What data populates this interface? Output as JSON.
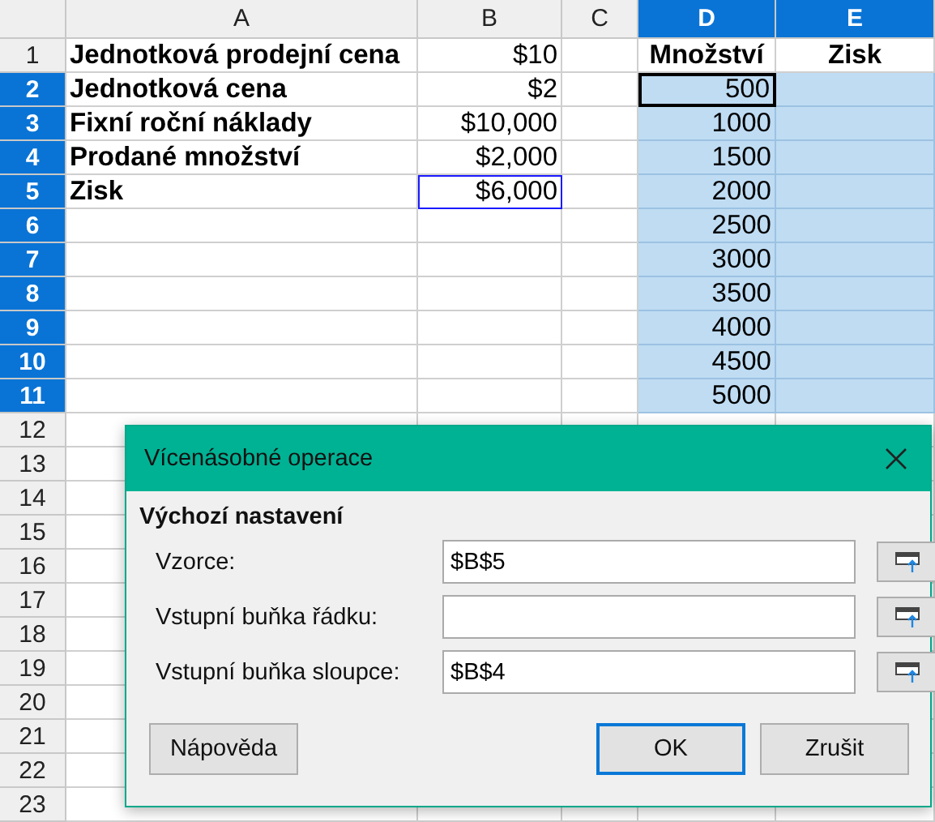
{
  "sheet": {
    "columns": [
      {
        "label": "A",
        "selected": false
      },
      {
        "label": "B",
        "selected": false
      },
      {
        "label": "C",
        "selected": false
      },
      {
        "label": "D",
        "selected": true
      },
      {
        "label": "E",
        "selected": true
      }
    ],
    "rows": [
      {
        "header": "1",
        "selected": false,
        "cells": [
          {
            "text": "Jednotková prodejní cena",
            "kind": "label",
            "selected": false
          },
          {
            "text": "$10",
            "kind": "number",
            "selected": false
          },
          {
            "selected": false
          },
          {
            "text": "Množství",
            "kind": "heading",
            "selected": false
          },
          {
            "text": "Zisk",
            "kind": "heading",
            "selected": false
          }
        ]
      },
      {
        "header": "2",
        "selected": true,
        "cells": [
          {
            "text": "Jednotková cena",
            "kind": "label",
            "selected": false
          },
          {
            "text": "$2",
            "kind": "number",
            "selected": false
          },
          {
            "selected": false
          },
          {
            "text": "500",
            "kind": "number",
            "selected": true,
            "active": true
          },
          {
            "selected": true
          }
        ]
      },
      {
        "header": "3",
        "selected": true,
        "cells": [
          {
            "text": "Fixní roční náklady",
            "kind": "label",
            "selected": false
          },
          {
            "text": "$10,000",
            "kind": "number",
            "selected": false
          },
          {
            "selected": false
          },
          {
            "text": "1000",
            "kind": "number",
            "selected": true
          },
          {
            "selected": true
          }
        ]
      },
      {
        "header": "4",
        "selected": true,
        "cells": [
          {
            "text": "Prodané množství",
            "kind": "label",
            "selected": false
          },
          {
            "text": "$2,000",
            "kind": "number",
            "selected": false
          },
          {
            "selected": false
          },
          {
            "text": "1500",
            "kind": "number",
            "selected": true
          },
          {
            "selected": true
          }
        ]
      },
      {
        "header": "5",
        "selected": true,
        "cells": [
          {
            "text": "Zisk",
            "kind": "label",
            "selected": false
          },
          {
            "text": "$6,000",
            "kind": "number",
            "selected": false,
            "referenced": true
          },
          {
            "selected": false
          },
          {
            "text": "2000",
            "kind": "number",
            "selected": true
          },
          {
            "selected": true
          }
        ]
      },
      {
        "header": "6",
        "selected": true,
        "cells": [
          {
            "selected": false
          },
          {
            "selected": false
          },
          {
            "selected": false
          },
          {
            "text": "2500",
            "kind": "number",
            "selected": true
          },
          {
            "selected": true
          }
        ]
      },
      {
        "header": "7",
        "selected": true,
        "cells": [
          {
            "selected": false
          },
          {
            "selected": false
          },
          {
            "selected": false
          },
          {
            "text": "3000",
            "kind": "number",
            "selected": true
          },
          {
            "selected": true
          }
        ]
      },
      {
        "header": "8",
        "selected": true,
        "cells": [
          {
            "selected": false
          },
          {
            "selected": false
          },
          {
            "selected": false
          },
          {
            "text": "3500",
            "kind": "number",
            "selected": true
          },
          {
            "selected": true
          }
        ]
      },
      {
        "header": "9",
        "selected": true,
        "cells": [
          {
            "selected": false
          },
          {
            "selected": false
          },
          {
            "selected": false
          },
          {
            "text": "4000",
            "kind": "number",
            "selected": true
          },
          {
            "selected": true
          }
        ]
      },
      {
        "header": "10",
        "selected": true,
        "cells": [
          {
            "selected": false
          },
          {
            "selected": false
          },
          {
            "selected": false
          },
          {
            "text": "4500",
            "kind": "number",
            "selected": true
          },
          {
            "selected": true
          }
        ]
      },
      {
        "header": "11",
        "selected": true,
        "cells": [
          {
            "selected": false
          },
          {
            "selected": false
          },
          {
            "selected": false
          },
          {
            "text": "5000",
            "kind": "number",
            "selected": true
          },
          {
            "selected": true
          }
        ]
      },
      {
        "header": "12",
        "selected": false
      },
      {
        "header": "13",
        "selected": false
      },
      {
        "header": "14",
        "selected": false
      },
      {
        "header": "15",
        "selected": false
      },
      {
        "header": "16",
        "selected": false
      },
      {
        "header": "17",
        "selected": false
      },
      {
        "header": "18",
        "selected": false
      },
      {
        "header": "19",
        "selected": false
      },
      {
        "header": "20",
        "selected": false
      },
      {
        "header": "21",
        "selected": false
      },
      {
        "header": "22",
        "selected": false
      },
      {
        "header": "23",
        "selected": false
      }
    ]
  },
  "dialog": {
    "title": "Vícenásobné operace",
    "section": "Výchozí nastavení",
    "fields": [
      {
        "label": "Vzorce:",
        "value": "$B$5"
      },
      {
        "label": "Vstupní buňka řádku:"
      },
      {
        "label": "Vstupní buňka sloupce:",
        "value": "$B$4"
      }
    ],
    "buttons": [
      {
        "label": "Nápověda",
        "default": false
      },
      {
        "label": "OK",
        "default": true
      },
      {
        "label": "Zrušit",
        "default": false
      }
    ]
  }
}
